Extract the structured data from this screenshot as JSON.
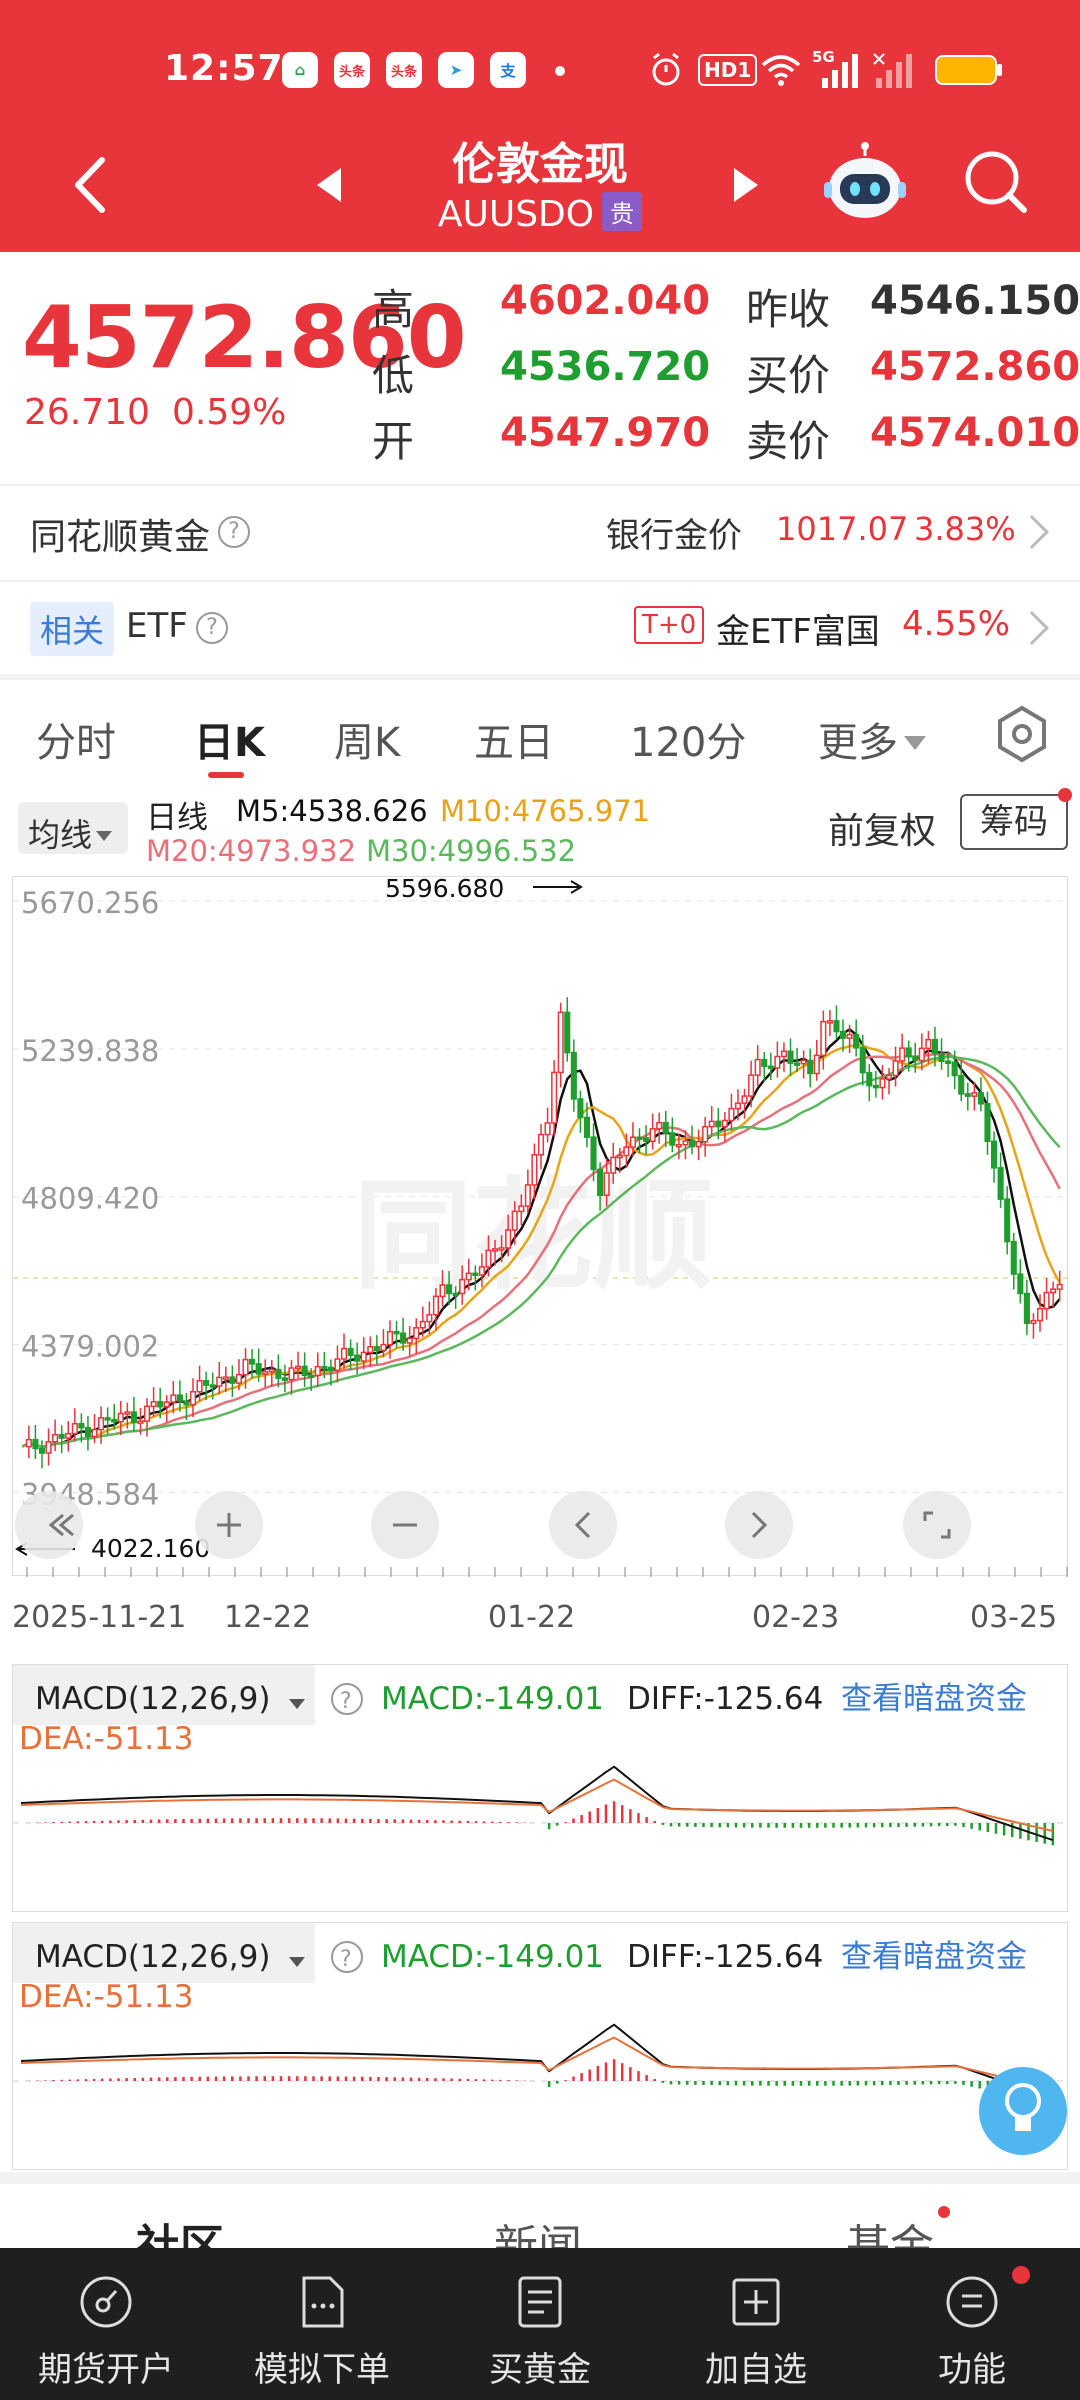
{
  "status_bar": {
    "time": "12:57",
    "apps": [
      "home-app",
      "toutiao",
      "toutiao",
      "telegram",
      "alipay"
    ],
    "right_icons": [
      "alarm-icon",
      "hd-icon",
      "wifi-icon",
      "signal-5g-icon",
      "signal-icon",
      "battery-icon"
    ],
    "hd_label": "HD1",
    "net_label": "5G"
  },
  "header": {
    "title": "伦敦金现",
    "code": "AUUSDO",
    "badge": "贵"
  },
  "quote": {
    "price": "4572.860",
    "change": "26.710",
    "change_pct": "0.59%",
    "high_label": "高",
    "high": "4602.040",
    "low_label": "低",
    "low": "4536.720",
    "open_label": "开",
    "open": "4547.970",
    "prev_label": "昨收",
    "prev": "4546.150",
    "bid_label": "买价",
    "bid": "4572.860",
    "ask_label": "卖价",
    "ask": "4574.010"
  },
  "rows": {
    "gold_label": "同花顺黄金",
    "bank_label": "银行金价",
    "bank_value": "1017.07",
    "bank_pct": "3.83%",
    "related_tag": "相关",
    "etf_label": "ETF",
    "t0_tag": "T+0",
    "etf_name": "金ETF富国",
    "etf_pct": "4.55%"
  },
  "tabs": [
    "分时",
    "日K",
    "周K",
    "五日",
    "120分",
    "更多"
  ],
  "legend": {
    "ma_select": "均线",
    "period": "日线",
    "m5": "M5:4538.626",
    "m10": "M10:4765.971",
    "m20": "M20:4973.932",
    "m30": "M30:4996.532",
    "fq": "前复权",
    "chip": "筹码"
  },
  "kline": {
    "y_ticks": [
      "5670.256",
      "5239.838",
      "4809.420",
      "4379.002",
      "3948.584"
    ],
    "max_label": "5596.680",
    "min_label": "4022.160",
    "watermark": "同花顺"
  },
  "dates": [
    "2025-11-21",
    "12-22",
    "01-22",
    "02-23",
    "03-25"
  ],
  "macd": {
    "title": "MACD(12,26,9)",
    "macd": "MACD:-149.01",
    "diff": "DIFF:-125.64",
    "link": "查看暗盘资金",
    "dea": "DEA:-51.13"
  },
  "subtabs": [
    "社区",
    "新闻",
    "基金"
  ],
  "nav": [
    "期货开户",
    "模拟下单",
    "买黄金",
    "加自选",
    "功能"
  ],
  "colors": {
    "brand_red": "#e8343b",
    "up_red": "#e8343b",
    "down_green": "#1e9e2e",
    "ma5": "#111111",
    "ma10": "#e8a317",
    "ma20": "#e8707a",
    "ma30": "#5cb85c",
    "link_blue": "#3a7bd5"
  }
}
